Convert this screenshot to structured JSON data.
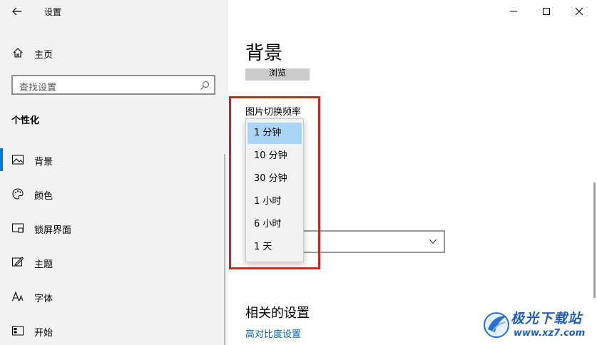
{
  "window": {
    "title": "设置"
  },
  "nav": {
    "home_label": "主页",
    "search_placeholder": "查找设置",
    "section_title": "个性化",
    "items": [
      {
        "label": "背景",
        "icon": "image-icon",
        "active": true
      },
      {
        "label": "颜色",
        "icon": "palette-icon"
      },
      {
        "label": "锁屏界面",
        "icon": "lock-screen-icon"
      },
      {
        "label": "主题",
        "icon": "theme-brush-icon"
      },
      {
        "label": "字体",
        "icon": "font-icon"
      },
      {
        "label": "开始",
        "icon": "start-grid-icon"
      }
    ]
  },
  "main": {
    "page_title": "背景",
    "browse_label": "浏览",
    "freq_label": "图片切换频率",
    "dropdown_options": [
      "1 分钟",
      "10 分钟",
      "30 分钟",
      "1 小时",
      "6 小时",
      "1 天"
    ],
    "selected_option": "1 分钟",
    "related_title": "相关的设置",
    "related_link": "高对比度设置"
  },
  "watermark": {
    "text": "极光下载站",
    "url": "www.xz7.com"
  },
  "colors": {
    "accent": "#0078d7",
    "highlight_border": "#d42020",
    "selected_option_bg": "#a9d6f5",
    "link": "#0066b4"
  }
}
